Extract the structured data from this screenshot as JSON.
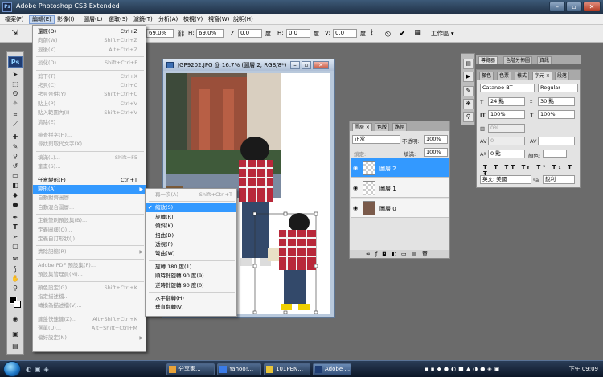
{
  "app": {
    "title": "Adobe Photoshop CS3 Extended",
    "logo": "Ps"
  },
  "menubar": [
    "檔案(F)",
    "編輯(E)",
    "影像(I)",
    "圖層(L)",
    "選取(S)",
    "濾鏡(T)",
    "分析(A)",
    "檢視(V)",
    "視窗(W)",
    "說明(H)"
  ],
  "options": {
    "w_value": "69.0%",
    "h_label": "H:",
    "h_value": "69.0%",
    "angle_value": "0.0",
    "angle_unit": "度",
    "hskew_label": "H:",
    "hskew_value": "0.0",
    "hskew_unit": "度",
    "vskew_label": "V:",
    "vskew_value": "0.0",
    "vskew_unit": "度",
    "workspace": "工作區 ▾"
  },
  "edit_menu": [
    {
      "label": "還原(O)",
      "shortcut": "Ctrl+Z"
    },
    {
      "label": "向前(W)",
      "shortcut": "Shift+Ctrl+Z",
      "disabled": true
    },
    {
      "label": "退後(K)",
      "shortcut": "Alt+Ctrl+Z",
      "disabled": true
    },
    {
      "sep": true
    },
    {
      "label": "淡化(D)...",
      "shortcut": "Shift+Ctrl+F",
      "disabled": true
    },
    {
      "sep": true
    },
    {
      "label": "剪下(T)",
      "shortcut": "Ctrl+X",
      "disabled": true
    },
    {
      "label": "拷貝(C)",
      "shortcut": "Ctrl+C",
      "disabled": true
    },
    {
      "label": "拷貝合併(Y)",
      "shortcut": "Shift+Ctrl+C",
      "disabled": true
    },
    {
      "label": "貼上(P)",
      "shortcut": "Ctrl+V",
      "disabled": true
    },
    {
      "label": "貼入範圍內(I)",
      "shortcut": "Shift+Ctrl+V",
      "disabled": true
    },
    {
      "label": "清除(E)",
      "shortcut": "",
      "disabled": true
    },
    {
      "sep": true
    },
    {
      "label": "檢查拼字(H)...",
      "shortcut": "",
      "disabled": true
    },
    {
      "label": "尋找與取代文字(X)...",
      "shortcut": "",
      "disabled": true
    },
    {
      "sep": true
    },
    {
      "label": "填滿(L)...",
      "shortcut": "Shift+F5",
      "disabled": true
    },
    {
      "label": "筆畫(S)...",
      "shortcut": "",
      "disabled": true
    },
    {
      "sep": true
    },
    {
      "label": "任意變形(F)",
      "shortcut": "Ctrl+T"
    },
    {
      "label": "變形(A)",
      "shortcut": "",
      "highlight": true,
      "submenu": true
    },
    {
      "label": "自動對齊圖層...",
      "shortcut": "",
      "disabled": true
    },
    {
      "label": "自動混合圖層...",
      "shortcut": "",
      "disabled": true
    },
    {
      "sep": true
    },
    {
      "label": "定義筆刷預設集(B)...",
      "shortcut": "",
      "disabled": true
    },
    {
      "label": "定義圖樣(Q)...",
      "shortcut": "",
      "disabled": true
    },
    {
      "label": "定義自訂形狀(J)...",
      "shortcut": "",
      "disabled": true
    },
    {
      "sep": true
    },
    {
      "label": "清除記憶(R)",
      "shortcut": "",
      "disabled": true,
      "submenu": true
    },
    {
      "sep": true
    },
    {
      "label": "Adobe PDF 預設集(P)...",
      "shortcut": "",
      "disabled": true
    },
    {
      "label": "預設集管理員(M)...",
      "shortcut": "",
      "disabled": true
    },
    {
      "sep": true
    },
    {
      "label": "顏色設定(G)...",
      "shortcut": "Shift+Ctrl+K",
      "disabled": true
    },
    {
      "label": "指定描述檔...",
      "shortcut": "",
      "disabled": true
    },
    {
      "label": "轉換為描述檔(V)...",
      "shortcut": "",
      "disabled": true
    },
    {
      "sep": true
    },
    {
      "label": "鍵盤快速鍵(Z)...",
      "shortcut": "Alt+Shift+Ctrl+K",
      "disabled": true
    },
    {
      "label": "選單(U)...",
      "shortcut": "Alt+Shift+Ctrl+M",
      "disabled": true
    },
    {
      "label": "偏好設定(N)",
      "shortcut": "",
      "disabled": true,
      "submenu": true
    }
  ],
  "transform_submenu": [
    {
      "label": "再一次(A)",
      "shortcut": "Shift+Ctrl+T",
      "disabled": true
    },
    {
      "sep": true
    },
    {
      "label": "縮放(S)",
      "highlight": true,
      "check": "✔"
    },
    {
      "label": "旋轉(R)"
    },
    {
      "label": "傾斜(K)"
    },
    {
      "label": "扭曲(D)"
    },
    {
      "label": "透視(P)"
    },
    {
      "label": "彎曲(W)"
    },
    {
      "sep": true
    },
    {
      "label": "旋轉 180 度(1)"
    },
    {
      "label": "順時針旋轉 90 度(9)"
    },
    {
      "label": "逆時針旋轉 90 度(0)"
    },
    {
      "sep": true
    },
    {
      "label": "水平翻轉(H)"
    },
    {
      "label": "垂直翻轉(V)"
    }
  ],
  "document": {
    "title": "JGP9202.JPG @ 16.7% (圖層 2, RGB/8*)"
  },
  "layers_panel": {
    "tabs": [
      "圖層 ×",
      "色版",
      "路徑"
    ],
    "blend_mode": "正常",
    "opacity_label": "不透明:",
    "opacity_value": "100%",
    "lock_label": "鎖定:",
    "fill_label": "填滿:",
    "fill_value": "100%",
    "layers": [
      {
        "name": "圖層 2",
        "selected": true
      },
      {
        "name": "圖層 1",
        "selected": false
      },
      {
        "name": "圖層 0",
        "selected": false
      }
    ]
  },
  "top_panel_tabs": [
    "導覽器",
    "色階分佈圖",
    "資訊"
  ],
  "char_panel": {
    "tabs": [
      "顏色",
      "色票",
      "樣式",
      "字元 ×",
      "段落"
    ],
    "font_family": "Cataneo BT",
    "font_style": "Regular",
    "font_size": "24 點",
    "leading": "30 點",
    "vscale": "100%",
    "hscale": "100%",
    "tracking": "0%",
    "kerning": "0",
    "baseline": "0 點",
    "color_label": "顏色:",
    "typestyles": [
      "T",
      "T",
      "TT",
      "Tr",
      "T¹",
      "T₁",
      "T",
      "Ŧ"
    ],
    "language": "英文: 美國",
    "antialias": "銳利"
  },
  "taskbar": {
    "tasks": [
      "分享家...",
      "Yahoo!...",
      "101PEN...",
      "Adobe ..."
    ],
    "clock": "下午 09:09"
  },
  "colors": {
    "highlight": "#3399ff",
    "menu_bg": "#f5f5f5"
  }
}
